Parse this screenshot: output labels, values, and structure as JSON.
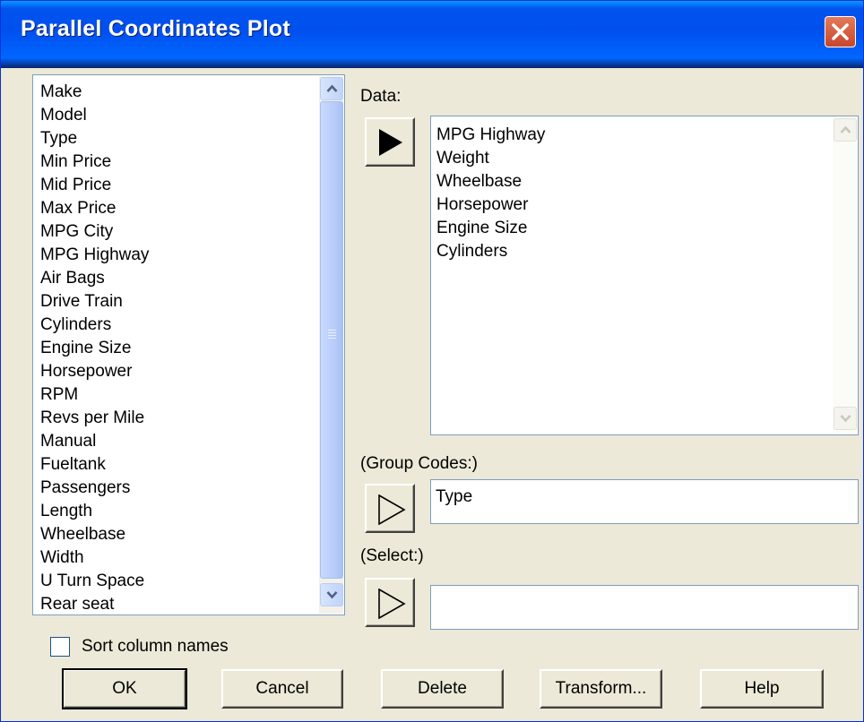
{
  "window": {
    "title": "Parallel Coordinates Plot"
  },
  "columns": {
    "items": [
      "Make",
      "Model",
      "Type",
      "Min Price",
      "Mid Price",
      "Max Price",
      "MPG City",
      "MPG Highway",
      "Air Bags",
      "Drive Train",
      "Cylinders",
      "Engine Size",
      "Horsepower",
      "RPM",
      "Revs per Mile",
      "Manual",
      "Fueltank",
      "Passengers",
      "Length",
      "Wheelbase",
      "Width",
      "U Turn Space",
      "Rear seat"
    ]
  },
  "data_section": {
    "label": "Data:",
    "items": [
      "MPG Highway",
      "Weight",
      "Wheelbase",
      "Horsepower",
      "Engine Size",
      "Cylinders"
    ]
  },
  "group_codes": {
    "label": "(Group Codes:)",
    "value": "Type"
  },
  "select": {
    "label": "(Select:)",
    "value": ""
  },
  "sort": {
    "label": "Sort column names",
    "checked": false
  },
  "buttons": {
    "ok": "OK",
    "cancel": "Cancel",
    "delete": "Delete",
    "transform": "Transform...",
    "help": "Help"
  },
  "icons": {
    "close": "close-icon",
    "arrow_active": "play-arrow-icon",
    "arrow_inactive": "hollow-arrow-icon"
  }
}
